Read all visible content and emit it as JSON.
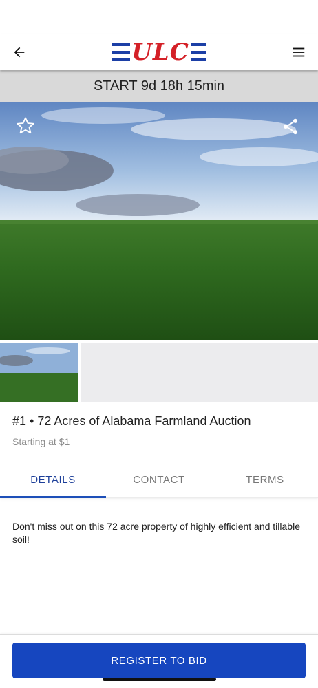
{
  "header": {
    "back_icon": "arrow-left-icon",
    "logo_text": "ULC",
    "logo_colors": {
      "bars": "#1c3fa6",
      "letters": "#d42027"
    },
    "menu_icon": "hamburger-menu-icon"
  },
  "countdown": {
    "text": "START 9d 18h 15min"
  },
  "hero": {
    "favorite_icon": "star-outline-icon",
    "share_icon": "share-icon"
  },
  "listing": {
    "title": "#1 • 72 Acres of Alabama Farmland Auction",
    "starting_price": "Starting at $1"
  },
  "tabs": [
    {
      "label": "DETAILS",
      "active": true
    },
    {
      "label": "CONTACT",
      "active": false
    },
    {
      "label": "TERMS",
      "active": false
    }
  ],
  "details": {
    "text": "Don't miss out on this 72 acre property of highly efficient and tillable soil!"
  },
  "footer": {
    "register_label": "REGISTER TO BID"
  },
  "colors": {
    "accent": "#1646bf",
    "tab_active": "#1d3f99",
    "countdown_bg": "#d9d9d9"
  }
}
